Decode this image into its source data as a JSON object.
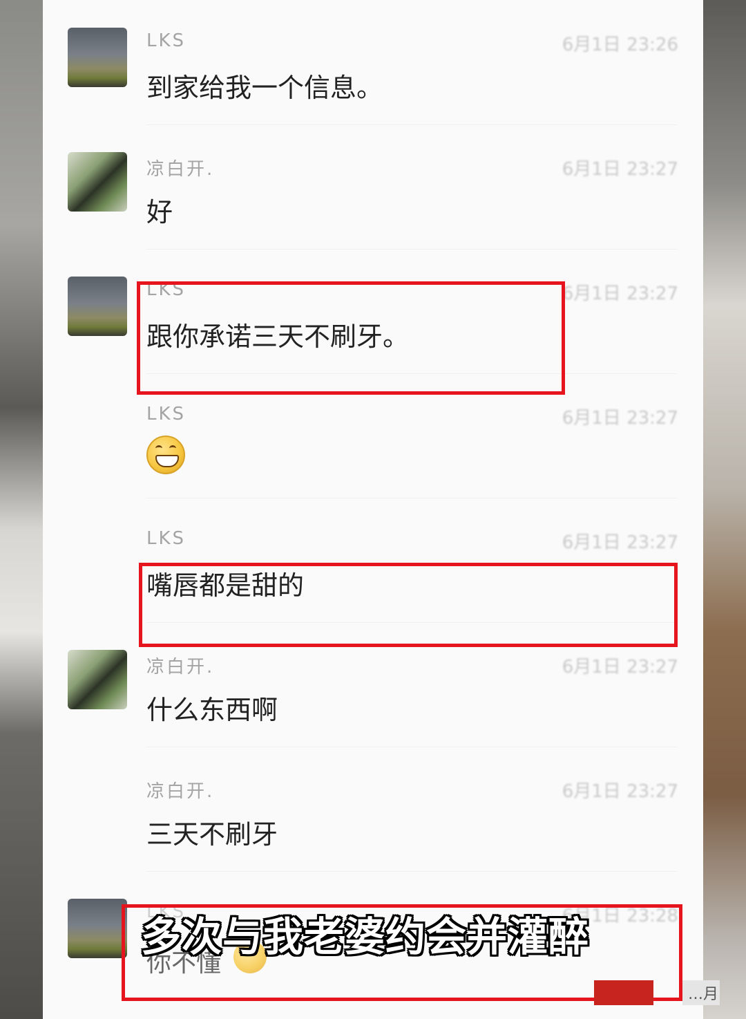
{
  "messages": [
    {
      "sender": "LKS",
      "time": "6月1日 23:26",
      "text": "到家给我一个信息。",
      "avatar": "avatar-lks"
    },
    {
      "sender": "凉白开.",
      "time": "6月1日 23:27",
      "text": "好",
      "avatar": "avatar-liangbaikai"
    },
    {
      "sender": "LKS",
      "time": "6月1日 23:27",
      "text": "跟你承诺三天不刷牙。",
      "avatar": "avatar-lks"
    },
    {
      "sender": "LKS",
      "time": "6月1日 23:27",
      "emoji": "grinning-face-emoji"
    },
    {
      "sender": "LKS",
      "time": "6月1日 23:27",
      "text": "嘴唇都是甜的"
    },
    {
      "sender": "凉白开.",
      "time": "6月1日 23:27",
      "text": "什么东西啊",
      "avatar": "avatar-liangbaikai"
    },
    {
      "sender": "凉白开.",
      "time": "6月1日 23:27",
      "text": "三天不刷牙"
    },
    {
      "sender": "LKS",
      "time": "6月1日 23:28",
      "text": "你不懂",
      "emoji": "grinning-face-emoji",
      "avatar": "avatar-lks"
    }
  ],
  "caption": "多次与我老婆约会并灌醉",
  "watermark": {
    "text": "…月"
  },
  "colors": {
    "highlight": "#e5141d",
    "panel": "#fafafa"
  }
}
